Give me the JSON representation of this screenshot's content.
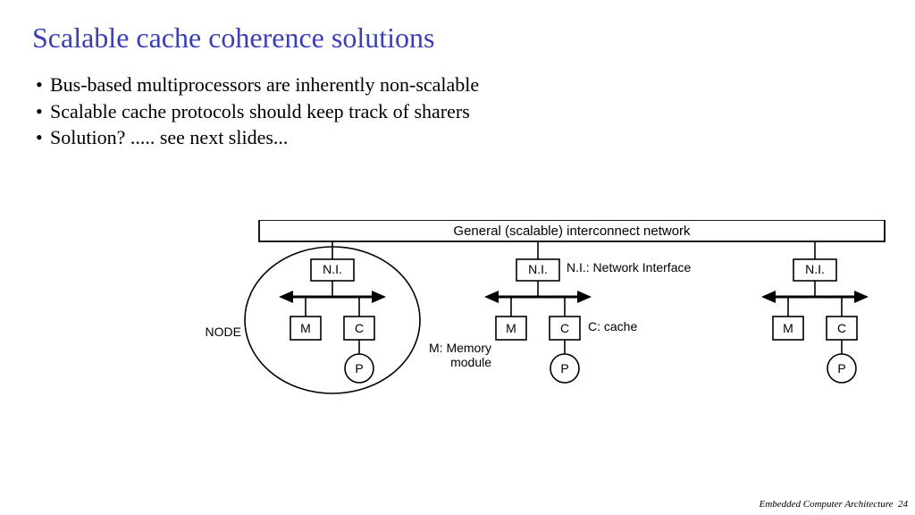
{
  "title": "Scalable cache coherence solutions",
  "bullets": [
    "Bus-based multiprocessors are inherently non-scalable",
    "Scalable cache protocols should keep track of sharers",
    "Solution? ..... see next slides..."
  ],
  "diagram": {
    "header": "General (scalable) interconnect network",
    "ni": "N.I.",
    "m": "M",
    "c": "C",
    "p": "P",
    "node_label": "NODE",
    "legend_ni": "N.I.: Network Interface",
    "legend_c": "C: cache",
    "legend_m_line1": "M: Memory",
    "legend_m_line2": "module"
  },
  "footer": {
    "text": "Embedded Computer Architecture",
    "page": "24"
  }
}
